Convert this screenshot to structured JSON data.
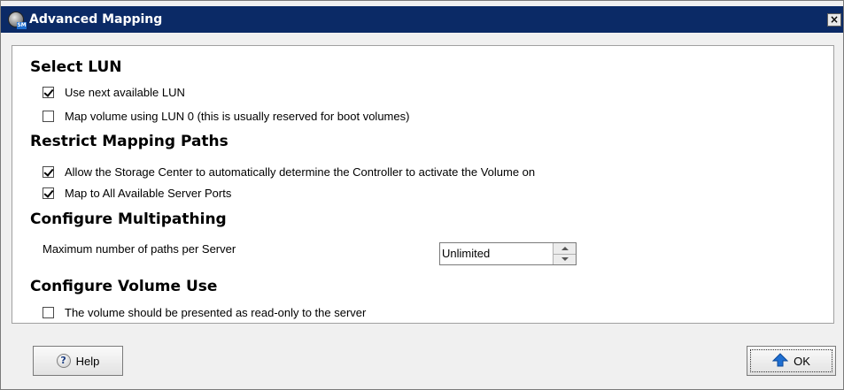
{
  "window": {
    "title": "Advanced Mapping",
    "close_label": "×",
    "app_icon_badge": "SM"
  },
  "sections": {
    "select_lun": {
      "title": "Select LUN",
      "use_next_available": {
        "label": "Use next available LUN",
        "checked": true
      },
      "map_lun0": {
        "label": "Map volume using LUN 0 (this is usually reserved for boot volumes)",
        "checked": false
      }
    },
    "restrict_paths": {
      "title": "Restrict Mapping Paths",
      "auto_controller": {
        "label": "Allow the Storage Center to automatically determine the Controller to activate the Volume on",
        "checked": true
      },
      "all_ports": {
        "label": "Map to All Available Server Ports",
        "checked": true
      }
    },
    "multipathing": {
      "title": "Configure Multipathing",
      "max_paths_label": "Maximum number of paths per Server",
      "max_paths_value": "Unlimited"
    },
    "volume_use": {
      "title": "Configure Volume Use",
      "read_only": {
        "label": "The volume should be presented as read-only to the server",
        "checked": false
      }
    }
  },
  "buttons": {
    "help_label": "Help",
    "help_icon": "?",
    "ok_label": "OK"
  },
  "icons": {
    "app": "storage-manager-icon",
    "close": "close-icon",
    "help": "help-icon",
    "ok": "up-arrow-icon"
  },
  "colors": {
    "titlebar": "#0b2a66",
    "ok_arrow": "#1f6fd1"
  }
}
